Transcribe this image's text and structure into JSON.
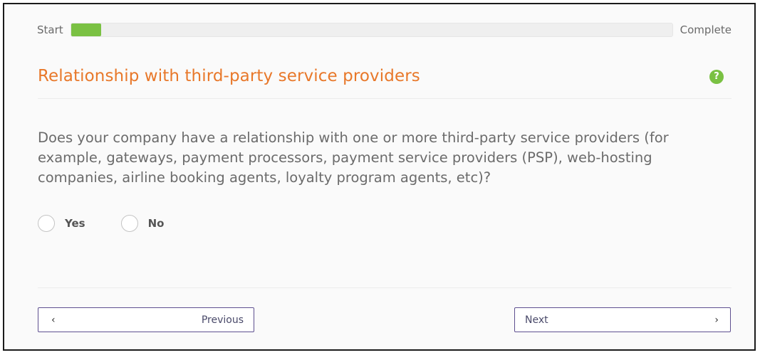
{
  "progress": {
    "start_label": "Start",
    "end_label": "Complete",
    "fraction": 0.05,
    "fill_color": "#7ac143"
  },
  "section": {
    "title": "Relationship with third-party service providers",
    "title_color": "#e8782a",
    "help_icon": "question-mark-icon",
    "help_glyph": "?"
  },
  "question": {
    "text": "Does your company have a relationship with one or more third-party service providers (for example, gateways, payment processors, payment service providers (PSP), web-hosting companies, airline booking agents, loyalty program agents, etc)?"
  },
  "options": [
    {
      "label": "Yes",
      "selected": false
    },
    {
      "label": "No",
      "selected": false
    }
  ],
  "navigation": {
    "previous_label": "Previous",
    "previous_icon": "chevron-left-icon",
    "next_label": "Next",
    "next_icon": "chevron-right-icon",
    "border_color": "#5e4f8f"
  }
}
